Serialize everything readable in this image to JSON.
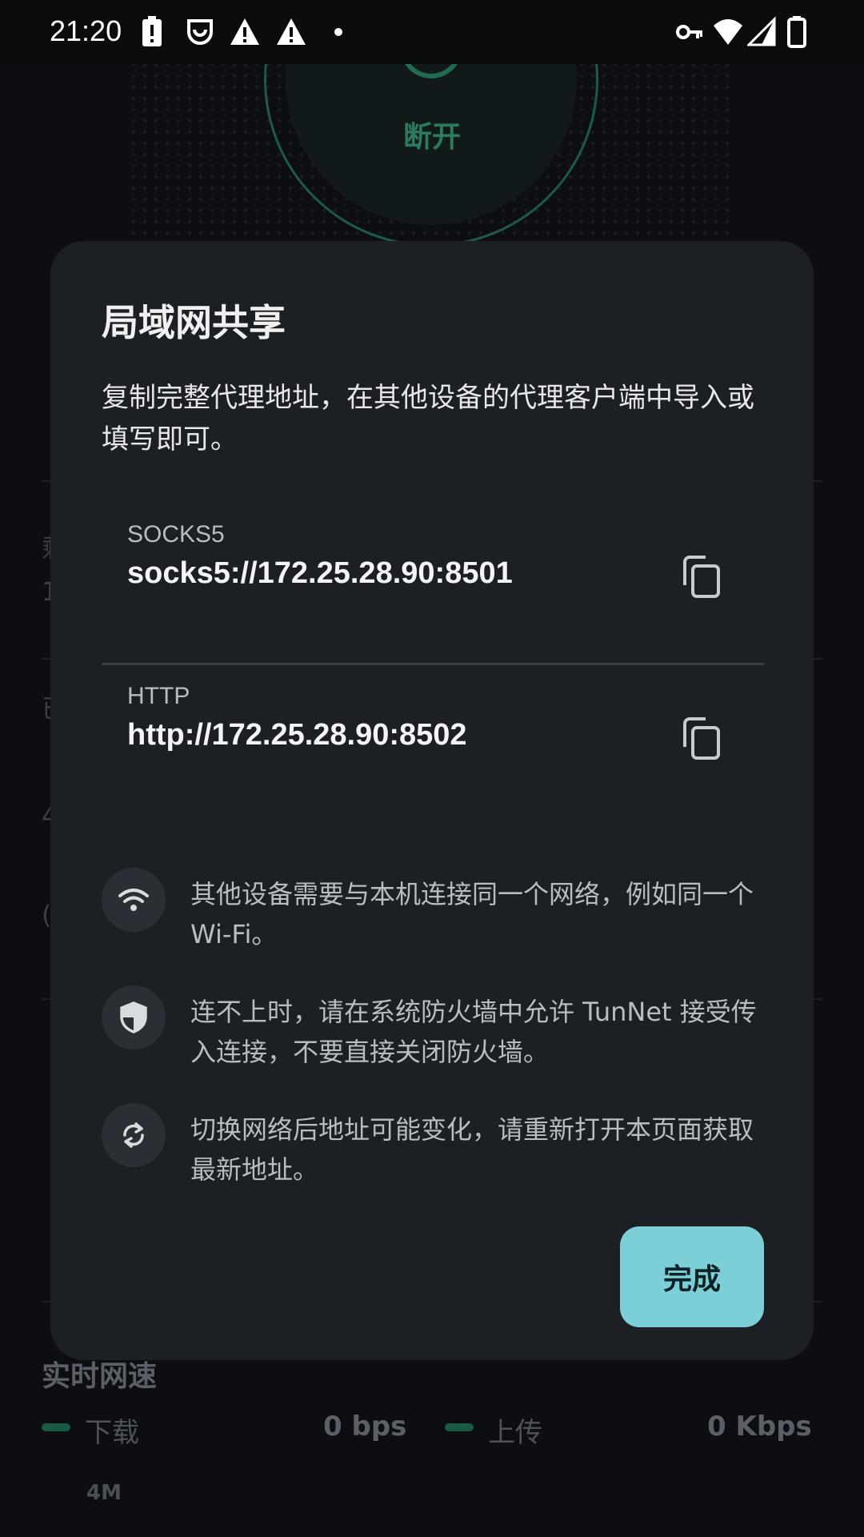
{
  "status_bar": {
    "time": "21:20"
  },
  "background": {
    "power_label": "断开",
    "frag_1": "剩",
    "frag_2": "1",
    "frag_3": "已",
    "frag_4": "4",
    "frag_5": "(",
    "speed_section_title": "实时网速",
    "download_label": "下载",
    "download_value": "0 bps",
    "upload_label": "上传",
    "upload_value": "0 Kbps",
    "axis_label": "4M"
  },
  "dialog": {
    "title": "局域网共享",
    "description": "复制完整代理地址，在其他设备的代理客户端中导入或填写即可。",
    "proxies": [
      {
        "label": "SOCKS5",
        "url": "socks5://172.25.28.90:8501",
        "icon": "copy-icon"
      },
      {
        "label": "HTTP",
        "url": "http://172.25.28.90:8502",
        "icon": "copy-icon"
      }
    ],
    "tips": [
      {
        "icon": "wifi-icon",
        "text": "其他设备需要与本机连接同一个网络，例如同一个 Wi-Fi。"
      },
      {
        "icon": "shield-icon",
        "text": "连不上时，请在系统防火墙中允许 TunNet 接受传入连接，不要直接关闭防火墙。"
      },
      {
        "icon": "sync-icon",
        "text": "切换网络后地址可能变化，请重新打开本页面获取最新地址。"
      }
    ],
    "done_label": "完成"
  },
  "colors": {
    "dialog_bg": "#1c1f23",
    "accent": "#7ccfd6",
    "connect_green": "#2c7a5e"
  }
}
